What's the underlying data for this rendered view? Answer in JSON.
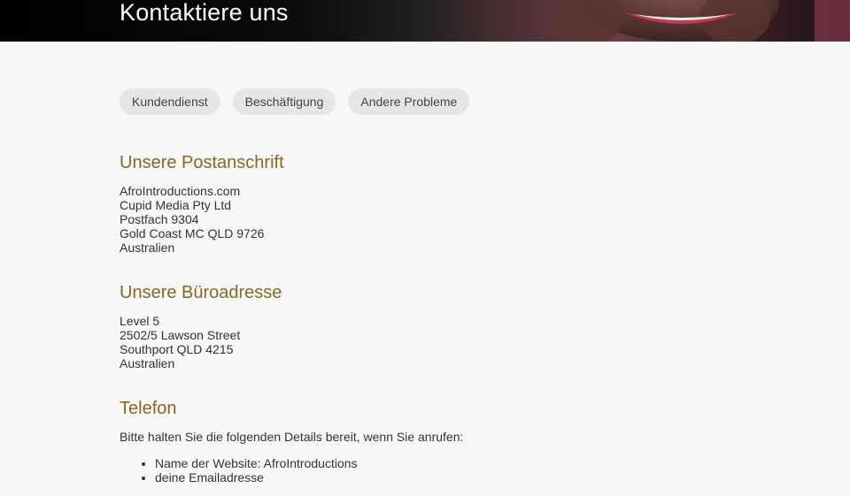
{
  "header": {
    "title": "Kontaktiere uns"
  },
  "tabs": [
    {
      "label": "Kundendienst"
    },
    {
      "label": "Beschäftigung"
    },
    {
      "label": "Andere Probleme"
    }
  ],
  "postal": {
    "heading": "Unsere Postanschrift",
    "lines": [
      "AfroIntroductions.com",
      "Cupid Media Pty Ltd",
      "Postfach 9304",
      "Gold Coast MC QLD 9726",
      "Australien"
    ]
  },
  "office": {
    "heading": "Unsere Büroadresse",
    "lines": [
      "Level 5",
      "2502/5 Lawson Street",
      "Southport QLD 4215",
      "Australien"
    ]
  },
  "phone": {
    "heading": "Telefon",
    "intro": "Bitte halten Sie die folgenden Details bereit, wenn Sie anrufen:",
    "items": [
      "Name der Website: AfroIntroductions",
      "deine Emailadresse"
    ]
  }
}
